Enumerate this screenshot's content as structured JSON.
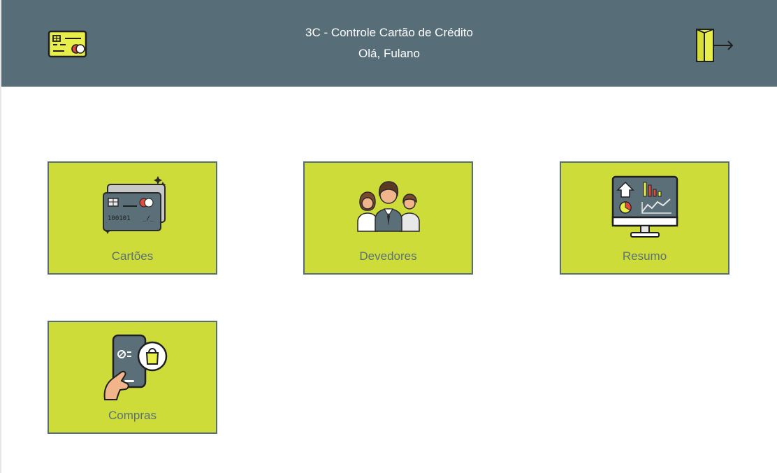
{
  "header": {
    "title": "3C - Controle Cartão de Crédito",
    "greeting": "Olá, Fulano",
    "logo_icon": "credit-card-icon",
    "logout_icon": "exit-door-icon"
  },
  "menu": {
    "items": [
      {
        "label": "Cartões",
        "icon": "credit-cards-icon"
      },
      {
        "label": "Devedores",
        "icon": "people-group-icon"
      },
      {
        "label": "Resumo",
        "icon": "dashboard-monitor-icon"
      },
      {
        "label": "Compras",
        "icon": "phone-shopping-icon"
      }
    ]
  },
  "colors": {
    "header_bg": "#576e78",
    "card_bg": "#cddc38",
    "card_border": "#576e78",
    "card_label": "#5c7177"
  }
}
